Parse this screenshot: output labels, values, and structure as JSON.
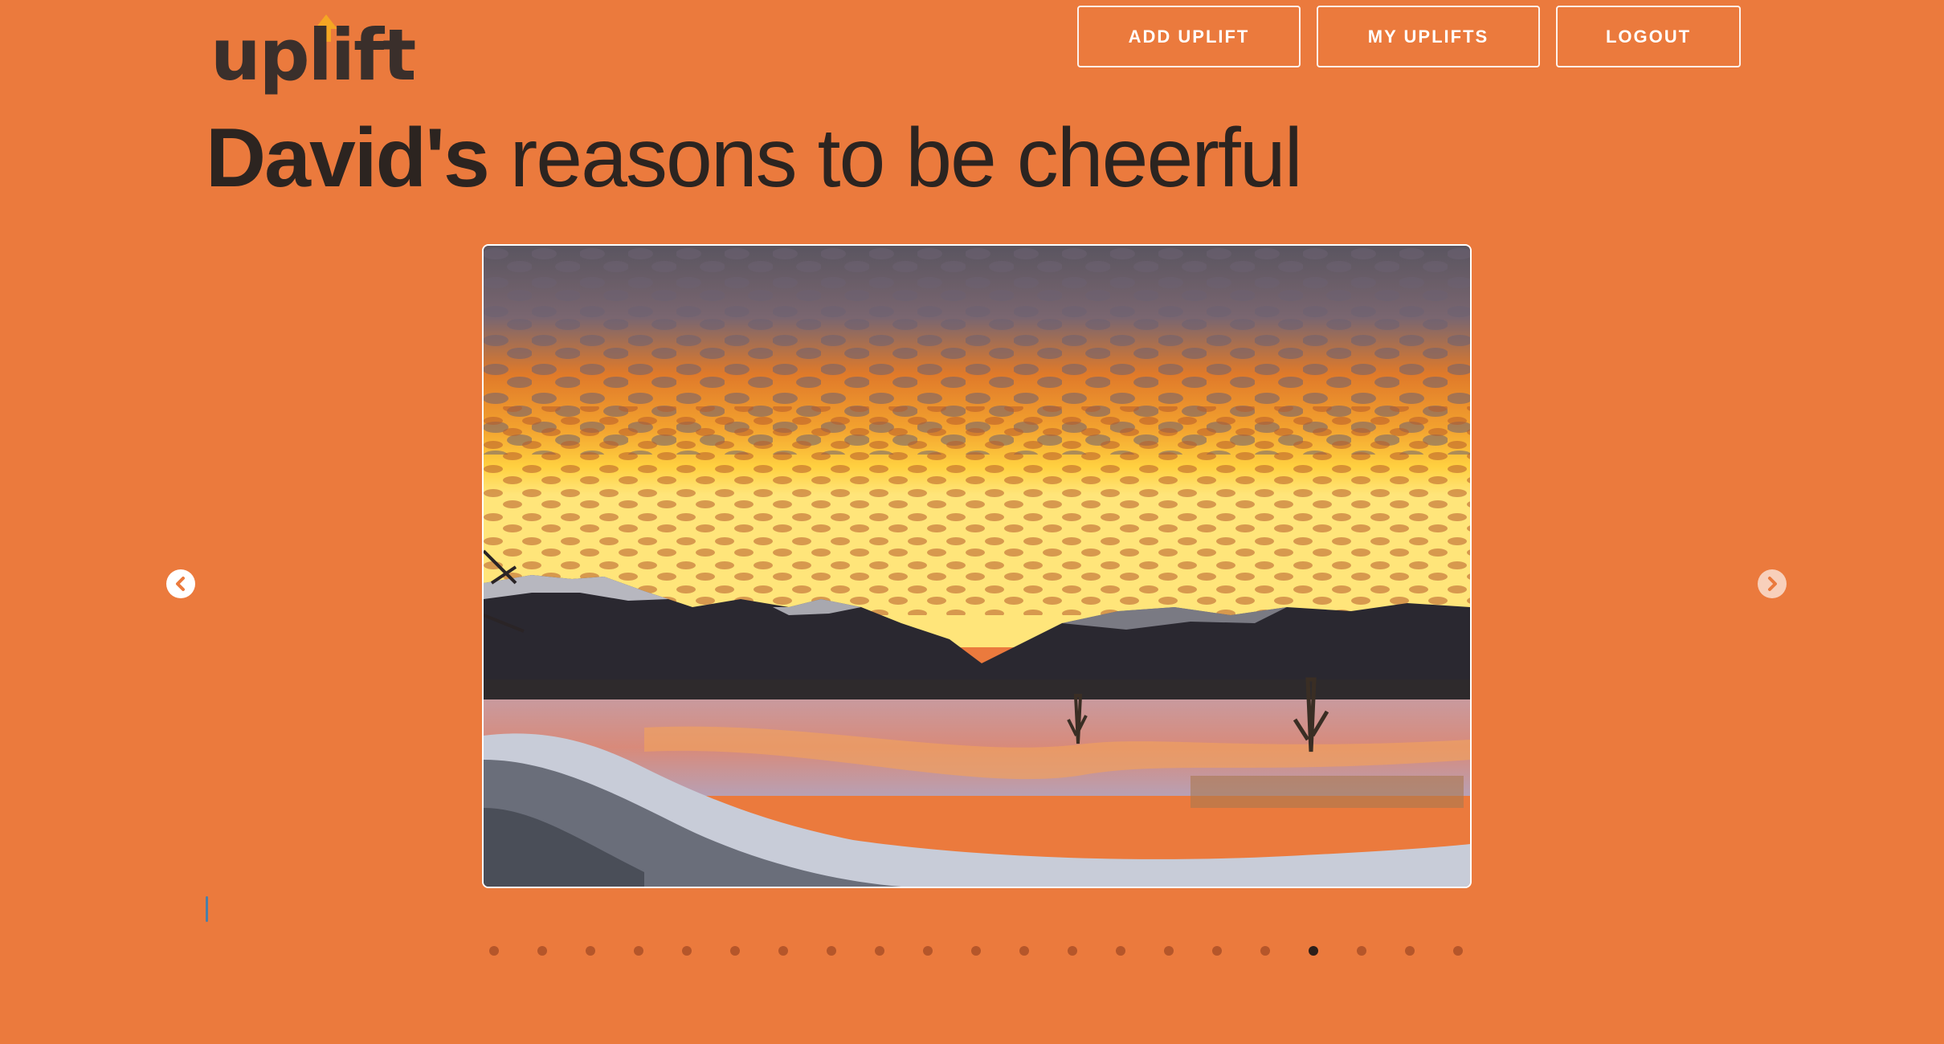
{
  "app": {
    "logo_text": "uplift"
  },
  "nav": {
    "add_label": "ADD UPLIFT",
    "mine_label": "MY UPLIFTS",
    "logout_label": "LOGOUT"
  },
  "heading": {
    "owner": "David's",
    "rest": " reasons to be cheerful"
  },
  "carousel": {
    "prev_icon": "chevron-left-circle-icon",
    "next_icon": "chevron-right-circle-icon",
    "slide_count": 21,
    "active_index": 17,
    "current_image": "sunset-over-snowy-mountains-and-frozen-lake"
  },
  "colors": {
    "background": "#EB7A3D",
    "text_dark": "#2C2420",
    "logo_accent": "#F5A623",
    "dot": "#B5562A",
    "dot_active": "#2C1F1A"
  }
}
